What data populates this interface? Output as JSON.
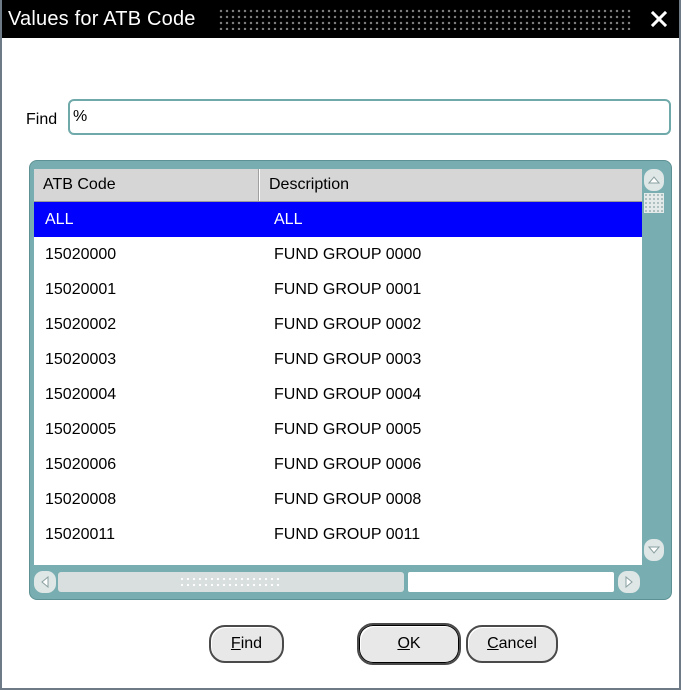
{
  "window": {
    "title": "Values for ATB Code",
    "close_symbol": "✕"
  },
  "find": {
    "label": "Find",
    "value": "%"
  },
  "grid": {
    "columns": [
      "ATB Code",
      "Description"
    ],
    "rows": [
      {
        "code": "ALL",
        "description": "ALL",
        "selected": true
      },
      {
        "code": "15020000",
        "description": "FUND GROUP 0000"
      },
      {
        "code": "15020001",
        "description": "FUND GROUP 0001"
      },
      {
        "code": "15020002",
        "description": "FUND GROUP 0002"
      },
      {
        "code": "15020003",
        "description": "FUND GROUP 0003"
      },
      {
        "code": "15020004",
        "description": "FUND GROUP 0004"
      },
      {
        "code": "15020005",
        "description": "FUND GROUP 0005"
      },
      {
        "code": "15020006",
        "description": "FUND GROUP 0006"
      },
      {
        "code": "15020008",
        "description": "FUND GROUP 0008"
      },
      {
        "code": "15020011",
        "description": "FUND GROUP 0011"
      }
    ]
  },
  "buttons": {
    "find": {
      "mnemonic": "F",
      "rest": "ind"
    },
    "ok": {
      "mnemonic": "O",
      "rest": "K"
    },
    "cancel": {
      "mnemonic": "C",
      "rest": "ancel"
    }
  },
  "colors": {
    "titlebar": "#000000",
    "selection": "#0000ff",
    "panel": "#78aeb1",
    "input_border": "#6fa9aa"
  },
  "icons": [
    "close-icon",
    "scroll-up-arrow-icon",
    "scroll-down-arrow-icon",
    "scroll-left-arrow-icon",
    "scroll-right-arrow-icon"
  ]
}
